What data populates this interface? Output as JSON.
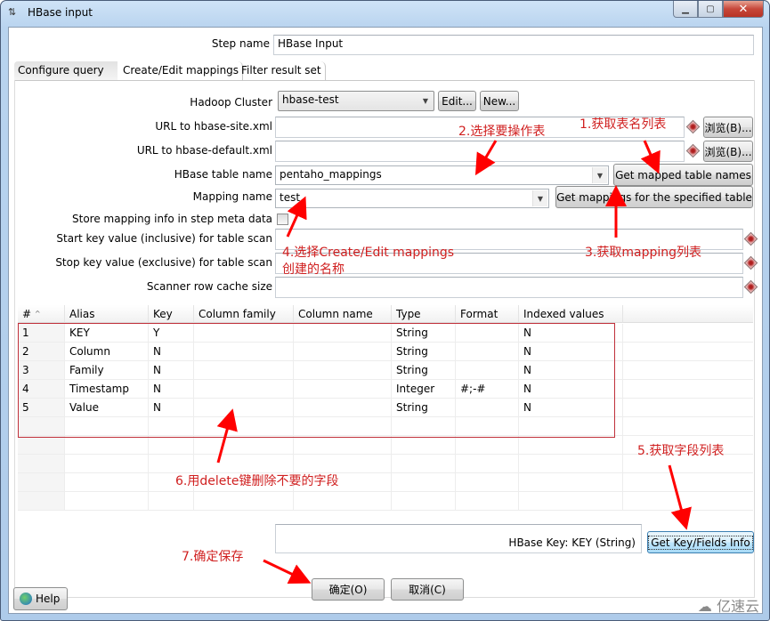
{
  "window": {
    "title": "HBase input",
    "icon": "hbase-step-icon",
    "controls": {
      "minimize": "—",
      "maximize": "▫",
      "close": "✕"
    }
  },
  "step_name": {
    "label": "Step name",
    "value": "HBase Input"
  },
  "tabs": [
    {
      "label": "Configure query",
      "active": true
    },
    {
      "label": "Create/Edit mappings",
      "active": false
    },
    {
      "label": "Filter result set",
      "active": false
    }
  ],
  "form": {
    "hadoop_cluster": {
      "label": "Hadoop Cluster",
      "value": "hbase-test",
      "edit_button": "Edit...",
      "new_button": "New..."
    },
    "hbase_site_url": {
      "label": "URL to hbase-site.xml",
      "value": "",
      "browse_button": "浏览(B)..."
    },
    "hbase_default_url": {
      "label": "URL to hbase-default.xml",
      "value": "",
      "browse_button": "浏览(B)..."
    },
    "hbase_table_name": {
      "label": "HBase table name",
      "value": "pentaho_mappings",
      "get_button": "Get mapped table names"
    },
    "mapping_name": {
      "label": "Mapping name",
      "value": "test",
      "get_button": "Get mappings for the specified table"
    },
    "store_mapping": {
      "label": "Store mapping info in step meta data",
      "checked": false
    },
    "start_key": {
      "label": "Start key value (inclusive) for table scan",
      "value": ""
    },
    "stop_key": {
      "label": "Stop key value (exclusive) for table scan",
      "value": ""
    },
    "scanner_cache": {
      "label": "Scanner row cache size",
      "value": ""
    }
  },
  "table": {
    "columns": [
      "#",
      "Alias",
      "Key",
      "Column family",
      "Column name",
      "Type",
      "Format",
      "Indexed values"
    ],
    "rows": [
      [
        "1",
        "KEY",
        "Y",
        "",
        "",
        "String",
        "",
        "N"
      ],
      [
        "2",
        "Column",
        "N",
        "",
        "",
        "String",
        "",
        "N"
      ],
      [
        "3",
        "Family",
        "N",
        "",
        "",
        "String",
        "",
        "N"
      ],
      [
        "4",
        "Timestamp",
        "N",
        "",
        "",
        "Integer",
        "#;-#",
        "N"
      ],
      [
        "5",
        "Value",
        "N",
        "",
        "",
        "String",
        "",
        "N"
      ]
    ]
  },
  "key_info": {
    "text": "HBase Key: KEY (String)",
    "button": "Get Key/Fields Info"
  },
  "footer": {
    "help": "Help",
    "ok": "确定(O)",
    "cancel": "取消(C)"
  },
  "annotations": {
    "a1": "1.获取表名列表",
    "a2": "2.选择要操作表",
    "a3": "3.获取mapping列表",
    "a4_line1": "4.选择Create/Edit mappings",
    "a4_line2": "创建的名称",
    "a5": "5.获取字段列表",
    "a6": "6.用delete键删除不要的字段",
    "a7": "7.确定保存",
    "color": "#d02020"
  },
  "watermark": "亿速云"
}
